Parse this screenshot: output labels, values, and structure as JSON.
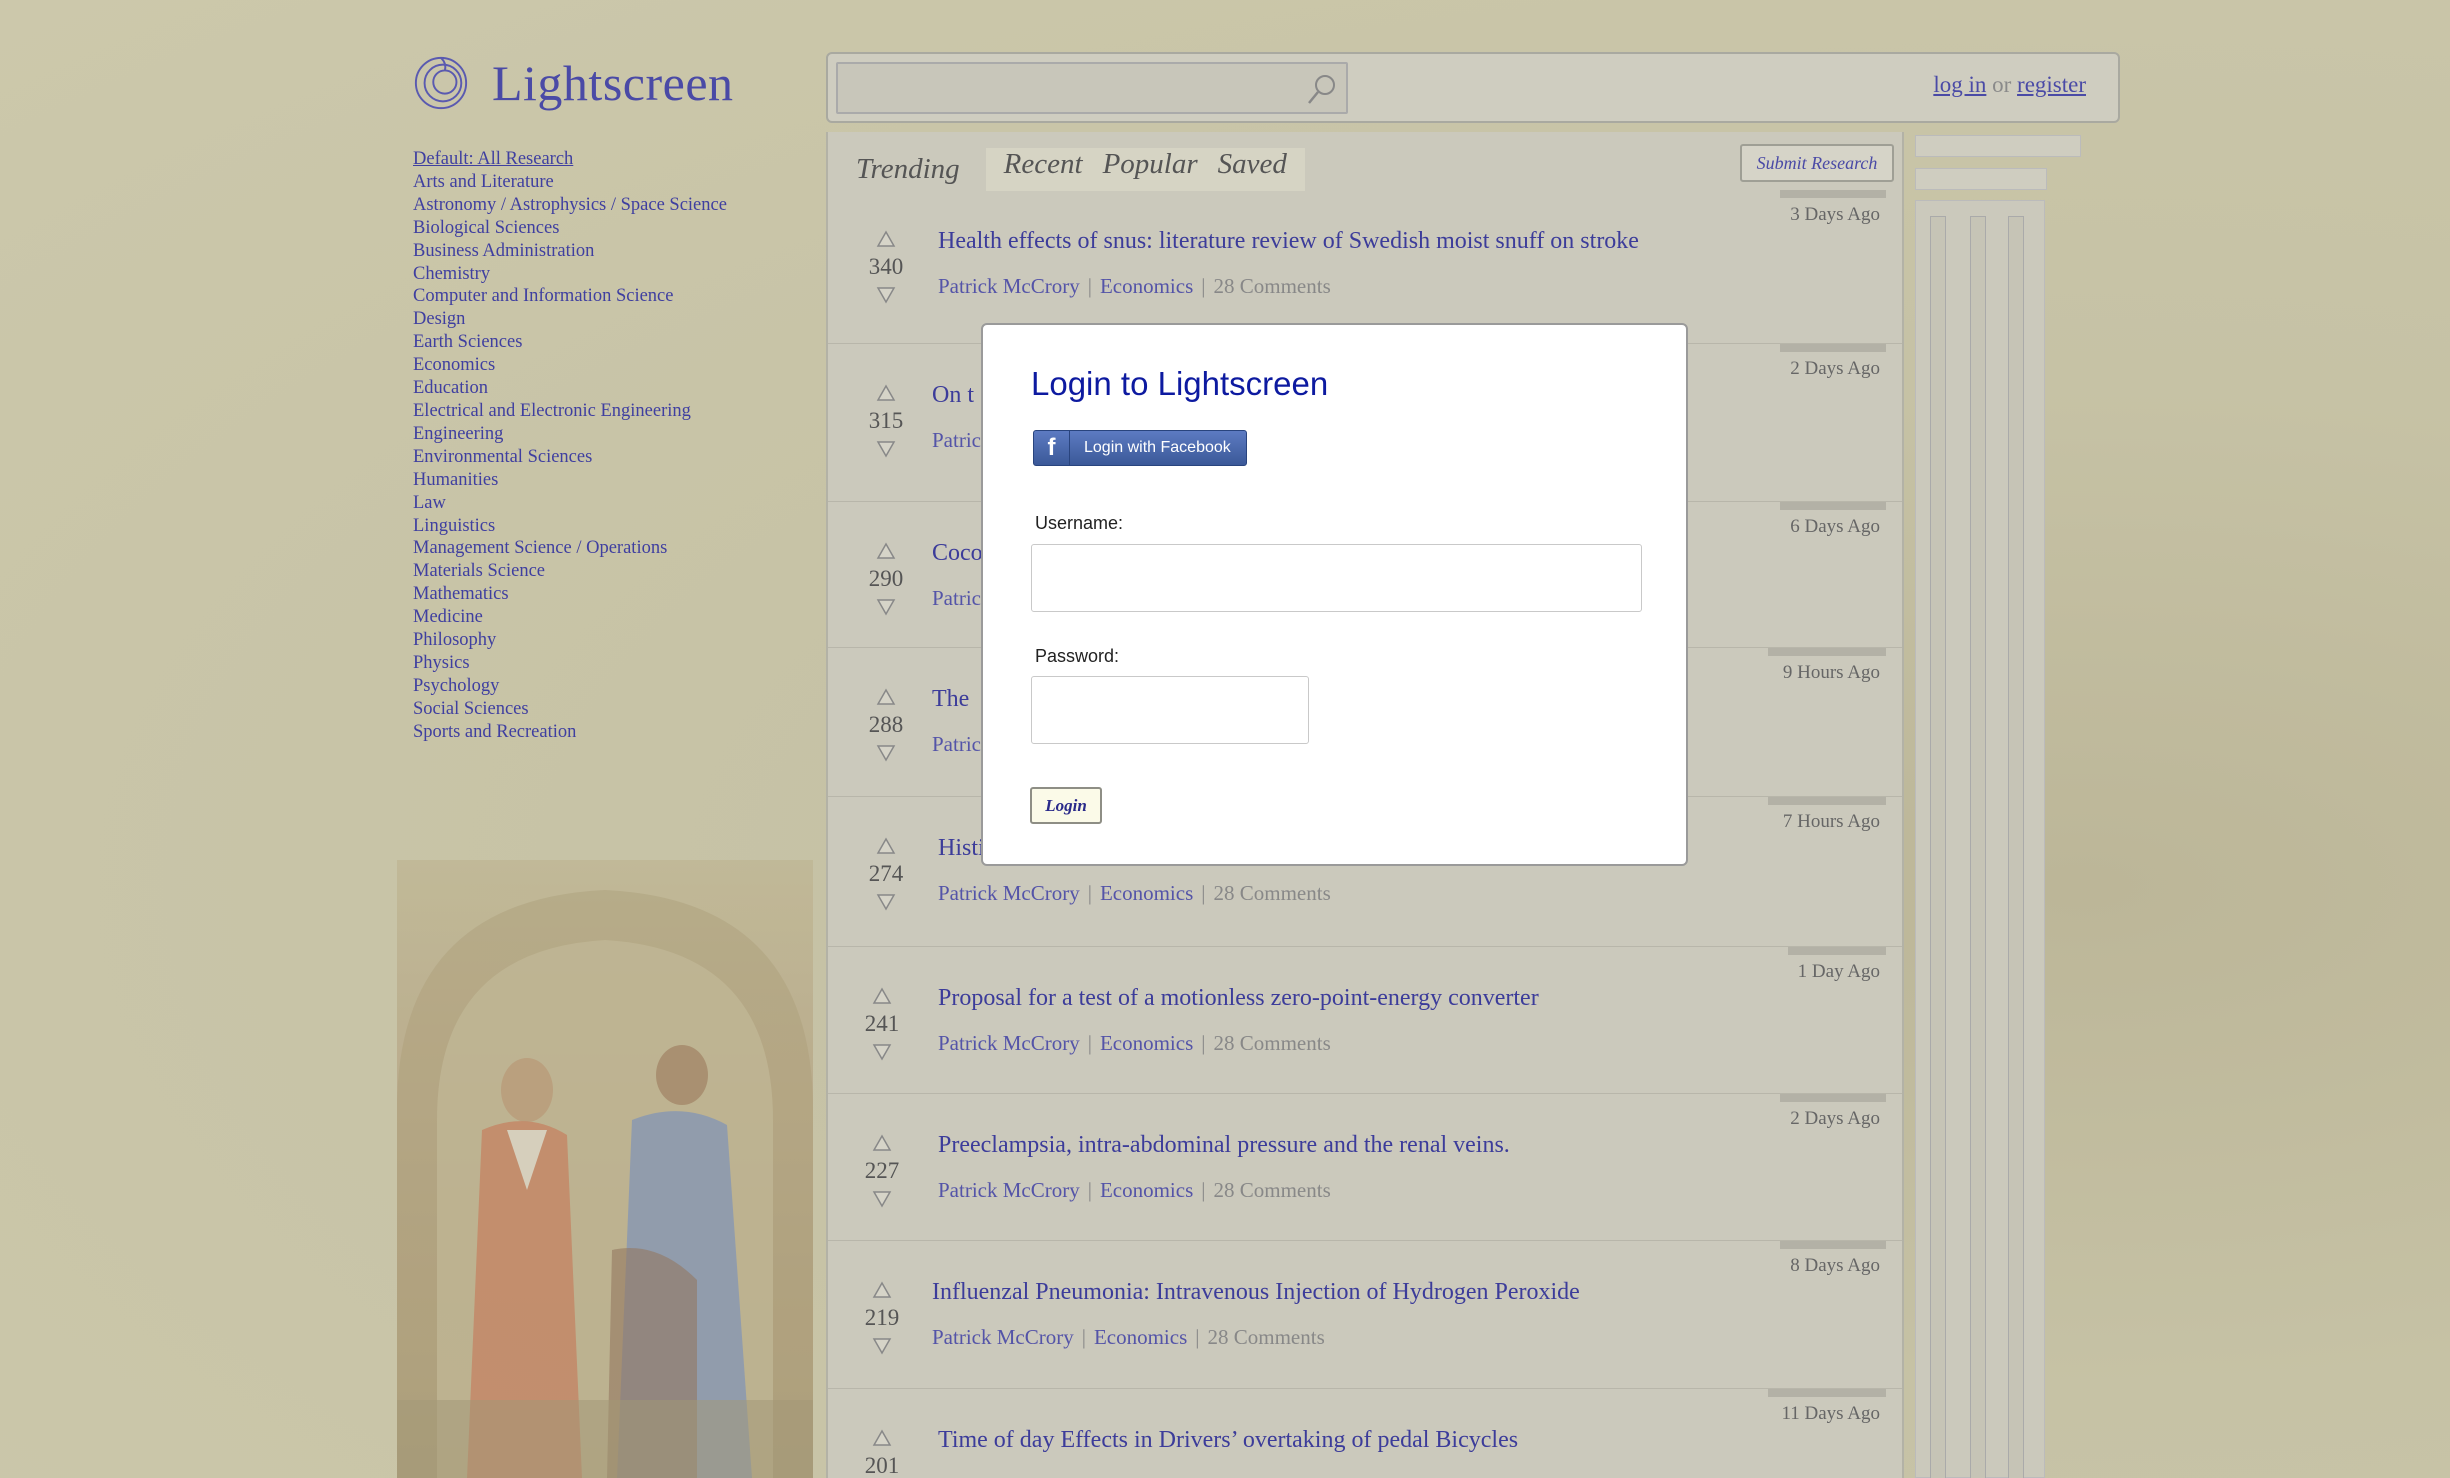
{
  "app": {
    "name": "Lightscreen"
  },
  "auth": {
    "login": "log in",
    "or": "or",
    "register": "register"
  },
  "search": {
    "placeholder": ""
  },
  "categories": {
    "default": "Default: All Research",
    "items": [
      "Arts and Literature",
      "Astronomy / Astrophysics / Space Science",
      "Biological Sciences",
      "Business Administration",
      "Chemistry",
      "Computer and Information Science",
      "Design",
      "Earth Sciences",
      "Economics",
      "Education",
      "Electrical and Electronic Engineering",
      "Engineering",
      "Environmental Sciences",
      "Humanities",
      "Law",
      "Linguistics",
      "Management Science / Operations",
      "Materials Science",
      "Mathematics",
      "Medicine",
      "Philosophy",
      "Physics",
      "Psychology",
      "Social Sciences",
      "Sports and Recreation"
    ]
  },
  "tabs": {
    "trending": "Trending",
    "recent": "Recent",
    "popular": "Popular",
    "saved": "Saved"
  },
  "submit": "Submit Research",
  "posts": [
    {
      "score": "340",
      "title": "Health effects of snus: literature review of Swedish moist snuff on stroke",
      "author": "Patrick McCrory",
      "category": "Economics",
      "comments": "28 Comments",
      "age": "3 Days Ago"
    },
    {
      "score": "315",
      "title": "On t",
      "author": "Patric",
      "category": "",
      "comments": "",
      "age": "2 Days Ago"
    },
    {
      "score": "290",
      "title": "Coco",
      "author": "Patric",
      "category": "",
      "comments": "",
      "age": "6 Days Ago"
    },
    {
      "score": "288",
      "title": "The ",
      "author": "Patric",
      "category": "",
      "comments": "",
      "age": "9 Hours Ago"
    },
    {
      "score": "274",
      "title": "Histi",
      "author": "Patrick McCrory",
      "category": "Economics",
      "comments": "28 Comments",
      "age": "7 Hours Ago"
    },
    {
      "score": "241",
      "title": "Proposal for a test of a motionless zero-point-energy converter",
      "author": "Patrick McCrory",
      "category": "Economics",
      "comments": "28 Comments",
      "age": "1 Day Ago"
    },
    {
      "score": "227",
      "title": "Preeclampsia, intra-abdominal pressure and the renal veins.",
      "author": "Patrick McCrory",
      "category": "Economics",
      "comments": "28 Comments",
      "age": "2 Days Ago"
    },
    {
      "score": "219",
      "title": "Influenzal Pneumonia: Intravenous Injection of Hydrogen Peroxide",
      "author": "Patrick McCrory",
      "category": "Economics",
      "comments": "28 Comments",
      "age": "8 Days Ago"
    },
    {
      "score": "201",
      "title": "Time of day Effects in Drivers’ overtaking of pedal Bicycles",
      "author": "",
      "category": "",
      "comments": "",
      "age": "11 Days Ago"
    }
  ],
  "modal": {
    "title": "Login to Lightscreen",
    "facebook": "Login with Facebook",
    "facebook_letter": "f",
    "username_label": "Username:",
    "username_value": "",
    "password_label": "Password:",
    "password_value": "",
    "login_button": "Login"
  }
}
